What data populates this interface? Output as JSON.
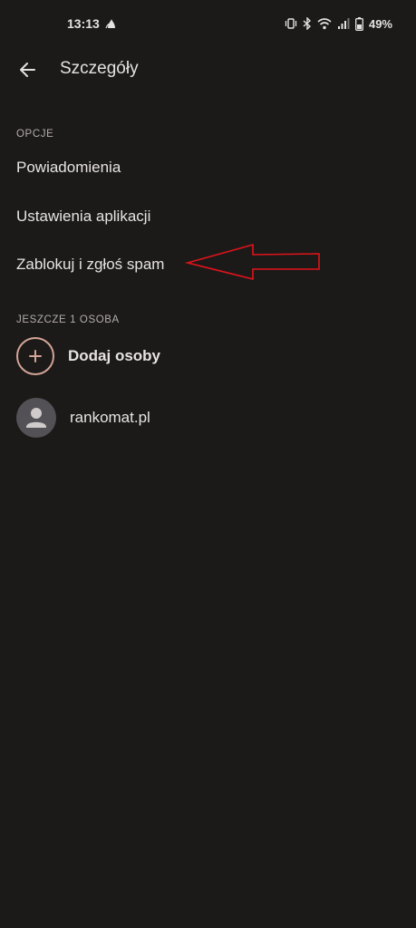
{
  "status_bar": {
    "time": "13:13",
    "battery": "49%",
    "icons": [
      "notification-icon",
      "vibrate-icon",
      "bluetooth-icon",
      "wifi-icon",
      "signal-icon",
      "battery-icon"
    ]
  },
  "header": {
    "back_icon": "arrow-left-icon",
    "title": "Szczegóły"
  },
  "options": {
    "section_label": "OPCJE",
    "items": [
      {
        "label": "Powiadomienia"
      },
      {
        "label": "Ustawienia aplikacji"
      },
      {
        "label": "Zablokuj i zgłoś spam"
      }
    ]
  },
  "people": {
    "section_label": "JESZCZE 1 OSOBA",
    "add_label": "Dodaj osoby",
    "members": [
      {
        "name": "rankomat.pl"
      }
    ]
  },
  "colors": {
    "background": "#1c1919",
    "text": "#e8e3e3",
    "section_text": "#b4adad",
    "accent_ring": "#d3a596",
    "annotation": "#e0141b"
  }
}
